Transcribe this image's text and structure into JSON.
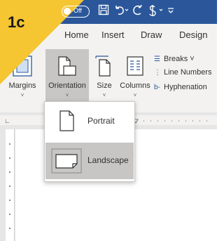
{
  "step_badge": {
    "label": "1c",
    "color": "#f5c532"
  },
  "quick_access": {
    "autosave_state": "Off",
    "icons": [
      "save-icon",
      "undo-icon",
      "redo-icon",
      "spelling-icon",
      "customize-icon"
    ]
  },
  "tabs": [
    {
      "label": "Home"
    },
    {
      "label": "Insert"
    },
    {
      "label": "Draw"
    },
    {
      "label": "Design"
    }
  ],
  "ribbon": {
    "margins_label": "Margins",
    "orientation_label": "Orientation",
    "size_label": "Size",
    "columns_label": "Columns",
    "breaks_label": "Breaks ˅",
    "line_numbers_label": "Line Numbers",
    "hyphenation_label": "Hyphenation"
  },
  "orientation_menu": {
    "items": [
      {
        "label": "Portrait",
        "selected": false
      },
      {
        "label": "Landscape",
        "selected": true
      }
    ]
  },
  "colors": {
    "title_bar": "#2b579a",
    "ribbon_bg": "#f3f2f1",
    "highlight": "#c8c6c4"
  }
}
